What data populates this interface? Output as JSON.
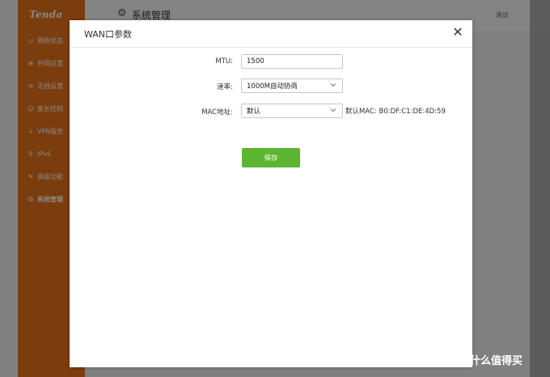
{
  "app": {
    "logo": "Tenda",
    "page_title": "系统管理",
    "logout_label": "退出"
  },
  "sidebar": {
    "items": [
      {
        "label": "网络状态",
        "icon": "monitor-icon"
      },
      {
        "label": "外网设置",
        "icon": "globe-icon"
      },
      {
        "label": "无线设置",
        "icon": "wifi-icon"
      },
      {
        "label": "家长控制",
        "icon": "parental-control-icon"
      },
      {
        "label": "VPN服务",
        "icon": "download-icon"
      },
      {
        "label": "IPv6",
        "icon": "wrench-icon"
      },
      {
        "label": "高级功能",
        "icon": "tools-icon"
      },
      {
        "label": "系统管理",
        "icon": "gear-icon",
        "active": true
      }
    ]
  },
  "dialog": {
    "title": "WAN口参数",
    "close_glyph": "✕",
    "mtu": {
      "label": "MTU:",
      "value": "1500"
    },
    "speed": {
      "label": "速率:",
      "value": "1000M自动协商"
    },
    "mac": {
      "label": "MAC地址:",
      "value": "默认",
      "note": "默认MAC: B0:DF:C1:DE:4D:59"
    },
    "save_label": "保存"
  },
  "watermark": {
    "badge": "值",
    "text": "什么值得买"
  },
  "colors": {
    "sidebar": "#e8731c",
    "save_button": "#5cb531"
  }
}
